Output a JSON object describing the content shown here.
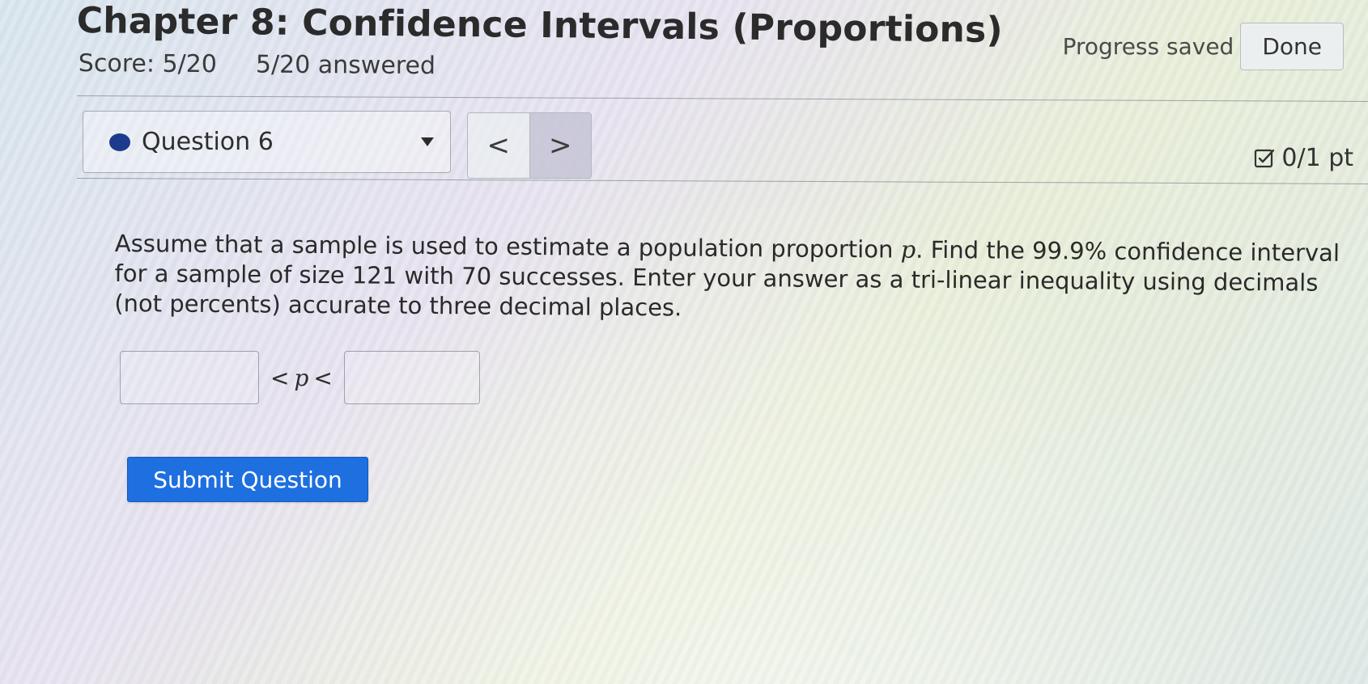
{
  "header": {
    "title": "Chapter 8: Confidence Intervals (Proportions)",
    "score": "Score: 5/20",
    "answered": "5/20 answered",
    "progress_status": "Progress saved",
    "done_label": "Done"
  },
  "question_nav": {
    "selected_question": "Question 6",
    "prev_symbol": "<",
    "next_symbol": ">",
    "points": "0/1 pt"
  },
  "question": {
    "text_part1": "Assume that a sample is used to estimate a population proportion ",
    "variable": "p",
    "text_part2": ". Find the 99.9% confidence interval for a sample of size 121 with 70 successes. Enter your answer as a tri-linear inequality using decimals (not percents) accurate to three decimal places.",
    "lower_value": "",
    "upper_value": "",
    "inequality_left": "<",
    "inequality_var": "p",
    "inequality_right": "<"
  },
  "actions": {
    "submit_label": "Submit Question"
  },
  "colors": {
    "submit_bg": "#1e6fe0",
    "question_dot": "#1d3b8c"
  }
}
